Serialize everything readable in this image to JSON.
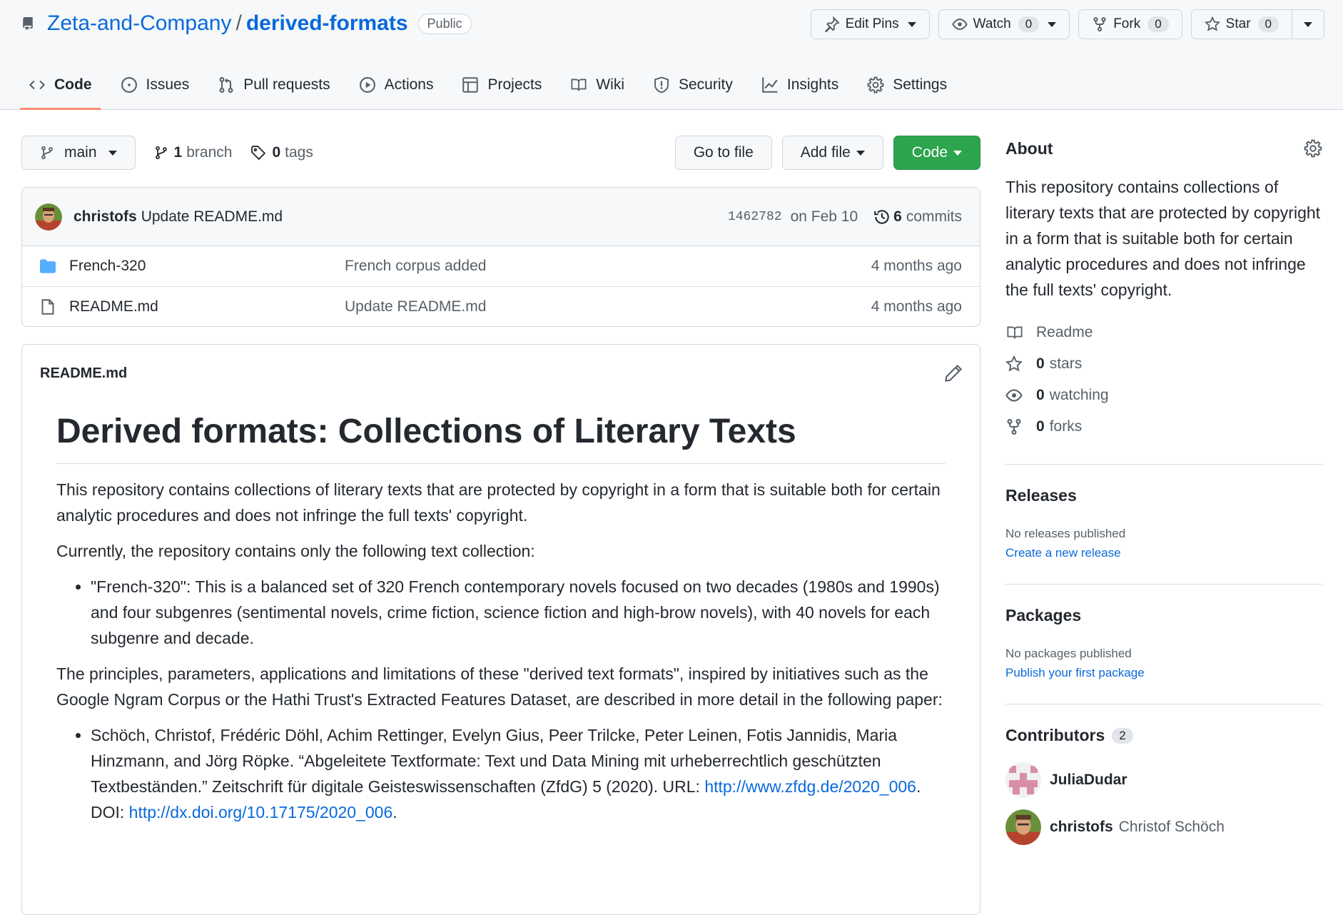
{
  "repo": {
    "owner": "Zeta-and-Company",
    "name": "derived-formats",
    "visibility": "Public"
  },
  "header_actions": {
    "edit_pins": "Edit Pins",
    "watch": "Watch",
    "watch_count": "0",
    "fork": "Fork",
    "fork_count": "0",
    "star": "Star",
    "star_count": "0"
  },
  "tabs": [
    {
      "label": "Code",
      "icon": "code-icon",
      "active": true
    },
    {
      "label": "Issues",
      "icon": "issue-icon"
    },
    {
      "label": "Pull requests",
      "icon": "pull-request-icon"
    },
    {
      "label": "Actions",
      "icon": "play-icon"
    },
    {
      "label": "Projects",
      "icon": "table-icon"
    },
    {
      "label": "Wiki",
      "icon": "book-icon"
    },
    {
      "label": "Security",
      "icon": "shield-icon"
    },
    {
      "label": "Insights",
      "icon": "graph-icon"
    },
    {
      "label": "Settings",
      "icon": "gear-icon"
    }
  ],
  "branch_bar": {
    "branch": "main",
    "branch_count": "1",
    "branch_label": "branch",
    "tag_count": "0",
    "tag_label": "tags",
    "go_to_file": "Go to file",
    "add_file": "Add file",
    "code": "Code"
  },
  "latest_commit": {
    "author": "christofs",
    "message": "Update README.md",
    "sha": "1462782",
    "date": "on Feb 10",
    "commit_count": "6",
    "commit_label": "commits"
  },
  "files": [
    {
      "type": "folder",
      "name": "French-320",
      "message": "French corpus added",
      "age": "4 months ago"
    },
    {
      "type": "file",
      "name": "README.md",
      "message": "Update README.md",
      "age": "4 months ago"
    }
  ],
  "readme": {
    "filename": "README.md",
    "h1": "Derived formats: Collections of Literary Texts",
    "p1": "This repository contains collections of literary texts that are protected by copyright in a form that is suitable both for certain analytic procedures and does not infringe the full texts' copyright.",
    "p2": "Currently, the repository contains only the following text collection:",
    "li1": "\"French-320\": This is a balanced set of 320 French contemporary novels focused on two decades (1980s and 1990s) and four subgenres (sentimental novels, crime fiction, science fiction and high-brow novels), with 40 novels for each subgenre and decade.",
    "p3": "The principles, parameters, applications and limitations of these \"derived text formats\", inspired by initiatives such as the Google Ngram Corpus or the Hathi Trust's Extracted Features Dataset, are described in more detail in the following paper:",
    "li2_text": "Schöch, Christof, Frédéric Döhl, Achim Rettinger, Evelyn Gius, Peer Trilcke, Peter Leinen, Fotis Jannidis, Maria Hinzmann, and Jörg Röpke. “Abgeleitete Textformate: Text und Data Mining mit urheberrechtlich geschützten Textbeständen.” Zeitschrift für digitale Geisteswissenschaften (ZfdG) 5 (2020). URL: ",
    "li2_url": "http://www.zfdg.de/2020_006",
    "li2_mid": ". DOI: ",
    "li2_doi": "http://dx.doi.org/10.17175/2020_006",
    "li2_end": "."
  },
  "about": {
    "heading": "About",
    "description": "This repository contains collections of literary texts that are protected by copyright in a form that is suitable both for certain analytic procedures and does not infringe the full texts' copyright.",
    "readme": "Readme",
    "stars_count": "0",
    "stars_label": "stars",
    "watching_count": "0",
    "watching_label": "watching",
    "forks_count": "0",
    "forks_label": "forks"
  },
  "releases": {
    "heading": "Releases",
    "none": "No releases published",
    "link": "Create a new release"
  },
  "packages": {
    "heading": "Packages",
    "none": "No packages published",
    "link": "Publish your first package"
  },
  "contributors": {
    "heading": "Contributors",
    "count": "2",
    "list": [
      {
        "login": "JuliaDudar",
        "name": ""
      },
      {
        "login": "christofs",
        "name": "Christof Schöch"
      }
    ]
  },
  "colors": {
    "accent": "#0969da",
    "green": "#2da44e",
    "active_tab_underline": "#fd8c73"
  }
}
